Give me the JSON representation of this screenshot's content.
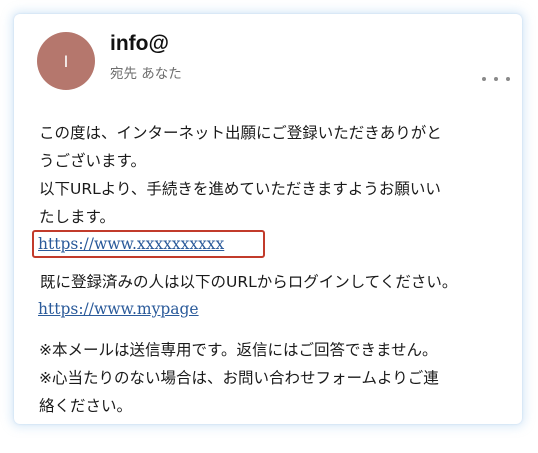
{
  "email": {
    "avatar_initial": "I",
    "sender": "info@",
    "recipient": "宛先 あなた",
    "more_icon": "more-horizontal-icon",
    "body": {
      "line1": "この度は、インターネット出願にご登録いただきありがと",
      "line2": "うございます。",
      "line3": "以下URLより、手続きを進めていただきますようお願いい",
      "line4": "たします。"
    },
    "link_primary": "https://www.xxxxxxxxxx",
    "after_link_text": "既に登録済みの人は以下のURLからログインしてください。",
    "link_mypage": "https://www.mypage",
    "notes": {
      "note1": "※本メールは送信専用です。返信にはご回答できません。",
      "note2": "※心当たりのない場合は、お問い合わせフォームよりご連",
      "note3": "絡ください。"
    }
  },
  "colors": {
    "avatar_bg": "#b5776d",
    "link": "#2a5a9a",
    "highlight_border": "#c23b2b"
  }
}
